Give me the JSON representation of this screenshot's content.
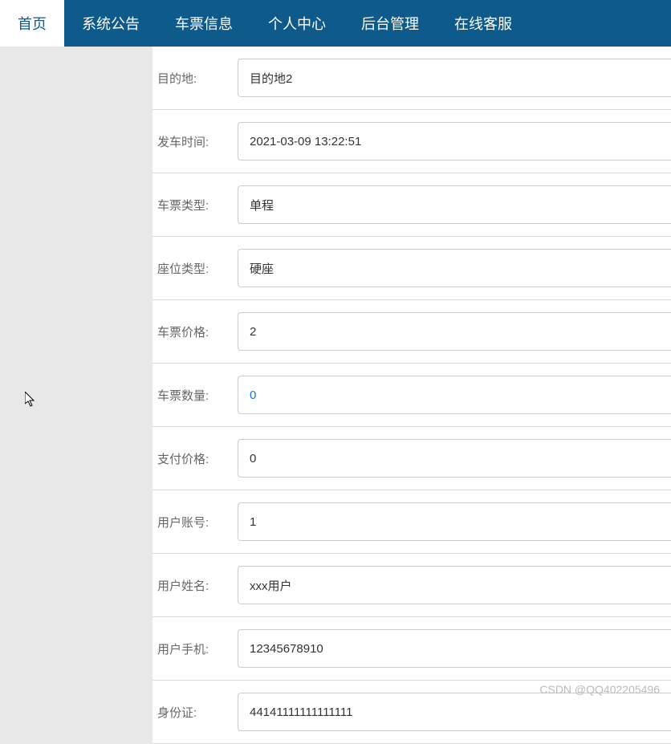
{
  "nav": {
    "items": [
      {
        "label": "首页",
        "active": true
      },
      {
        "label": "系统公告",
        "active": false
      },
      {
        "label": "车票信息",
        "active": false
      },
      {
        "label": "个人中心",
        "active": false
      },
      {
        "label": "后台管理",
        "active": false
      },
      {
        "label": "在线客服",
        "active": false
      }
    ]
  },
  "form": {
    "fields": [
      {
        "label": "目的地:",
        "value": "目的地2",
        "name": "destination"
      },
      {
        "label": "发车时间:",
        "value": "2021-03-09 13:22:51",
        "name": "depart-time"
      },
      {
        "label": "车票类型:",
        "value": "单程",
        "name": "ticket-type"
      },
      {
        "label": "座位类型:",
        "value": "硬座",
        "name": "seat-type"
      },
      {
        "label": "车票价格:",
        "value": "2",
        "name": "ticket-price"
      },
      {
        "label": "车票数量:",
        "value": "0",
        "name": "ticket-qty",
        "selected": true
      },
      {
        "label": "支付价格:",
        "value": "0",
        "name": "pay-price"
      },
      {
        "label": "用户账号:",
        "value": "1",
        "name": "user-account"
      },
      {
        "label": "用户姓名:",
        "value": "xxx用户",
        "name": "user-name"
      },
      {
        "label": "用户手机:",
        "value": "12345678910",
        "name": "user-phone"
      },
      {
        "label": "身份证:",
        "value": "44141111111111111",
        "name": "id-card"
      }
    ]
  },
  "watermark": "CSDN @QQ402205496"
}
